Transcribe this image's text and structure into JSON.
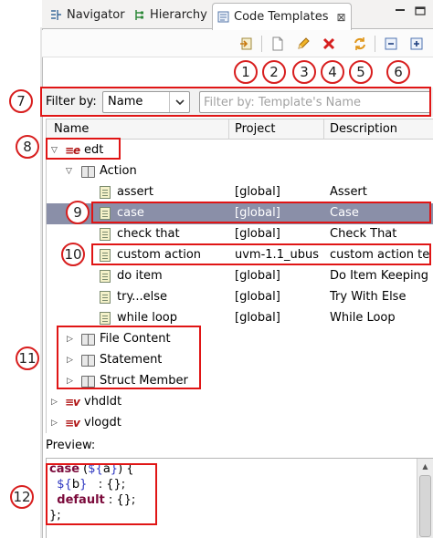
{
  "tabs": [
    {
      "label": "Navigator",
      "icon": "navigator-icon"
    },
    {
      "label": "Hierarchy",
      "icon": "hierarchy-icon"
    },
    {
      "label": "Code Templates",
      "icon": "code-templates-icon",
      "active": true
    }
  ],
  "tab_close_symbol": "⊠",
  "toolbar": {
    "buttons": [
      {
        "icon": "import-icon"
      },
      {
        "icon": "new-template-icon"
      },
      {
        "icon": "edit-pencil-icon"
      },
      {
        "icon": "delete-icon"
      },
      {
        "icon": "refresh-icon"
      },
      {
        "icon": "collapse-all-icon"
      },
      {
        "icon": "expand-all-icon"
      }
    ]
  },
  "callouts": [
    "1",
    "2",
    "3",
    "4",
    "5",
    "6",
    "7",
    "8",
    "9",
    "10",
    "11",
    "12"
  ],
  "filter": {
    "label": "Filter by:",
    "selected": "Name",
    "placeholder": "Filter by: Template's Name"
  },
  "table": {
    "columns": [
      "Name",
      "Project",
      "Description"
    ],
    "rows": [
      {
        "name": "edt",
        "level": 0,
        "kind": "language",
        "lang_glyph": "≡e",
        "expanded": true
      },
      {
        "name": "Action",
        "level": 1,
        "kind": "group",
        "expanded": true
      },
      {
        "name": "assert",
        "level": 2,
        "kind": "template",
        "project": "[global]",
        "description": "Assert"
      },
      {
        "name": "case",
        "level": 2,
        "kind": "template",
        "project": "[global]",
        "description": "Case",
        "selected": true
      },
      {
        "name": "check that",
        "level": 2,
        "kind": "template",
        "project": "[global]",
        "description": "Check That"
      },
      {
        "name": "custom action",
        "level": 2,
        "kind": "template",
        "project": "uvm-1.1_ubus",
        "description": "custom action te"
      },
      {
        "name": "do item",
        "level": 2,
        "kind": "template",
        "project": "[global]",
        "description": "Do Item Keeping"
      },
      {
        "name": "try...else",
        "level": 2,
        "kind": "template",
        "project": "[global]",
        "description": "Try With Else"
      },
      {
        "name": "while loop",
        "level": 2,
        "kind": "template",
        "project": "[global]",
        "description": "While Loop"
      },
      {
        "name": "File Content",
        "level": 1,
        "kind": "group",
        "expanded": false
      },
      {
        "name": "Statement",
        "level": 1,
        "kind": "group",
        "expanded": false
      },
      {
        "name": "Struct Member",
        "level": 1,
        "kind": "group",
        "expanded": false
      },
      {
        "name": "vhdldt",
        "level": 0,
        "kind": "language",
        "lang_glyph": "≡v",
        "expanded": false
      },
      {
        "name": "vlogdt",
        "level": 0,
        "kind": "language",
        "lang_glyph": "≡v",
        "expanded": false
      }
    ]
  },
  "preview": {
    "label": "Preview:",
    "lines": [
      [
        {
          "t": "case",
          "k": "kw"
        },
        {
          "t": " ("
        },
        {
          "t": "${",
          "k": "var"
        },
        {
          "t": "a"
        },
        {
          "t": "}",
          "k": "var"
        },
        {
          "t": ") {"
        }
      ],
      [
        {
          "t": "  "
        },
        {
          "t": "${",
          "k": "var"
        },
        {
          "t": "b"
        },
        {
          "t": "}",
          "k": "var"
        },
        {
          "t": "   : {};"
        }
      ],
      [
        {
          "t": "  "
        },
        {
          "t": "default",
          "k": "kw"
        },
        {
          "t": " : {};"
        }
      ],
      [
        {
          "t": "};"
        }
      ]
    ]
  },
  "colors": {
    "accent_red": "#e01515",
    "selection": "#8a8fa8",
    "keyword": "#7b0a3b",
    "variable": "#2b34c0"
  }
}
